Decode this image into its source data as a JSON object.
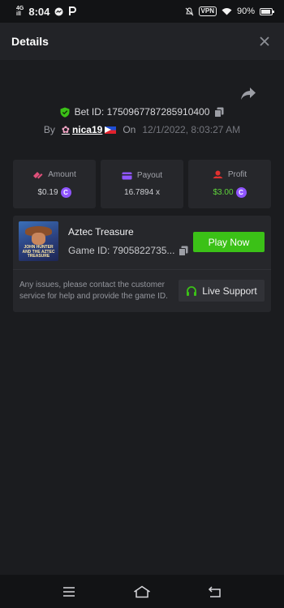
{
  "status_bar": {
    "network_top": "4G",
    "network_bottom": "ill",
    "time": "8:04",
    "vpn": "VPN",
    "battery": "90%"
  },
  "header": {
    "title": "Details"
  },
  "bet": {
    "id_label": "Bet ID: 1750967787285910400",
    "by_label": "By",
    "username": "nica19",
    "on_label": "On",
    "date": "12/1/2022, 8:03:27 AM"
  },
  "stats": [
    {
      "label": "Amount",
      "value": "$0.19",
      "icon": "coins-icon",
      "color": "#e0507a"
    },
    {
      "label": "Payout",
      "value": "16.7894 x",
      "icon": "card-icon",
      "color": "#8f55ff"
    },
    {
      "label": "Profit",
      "value": "$3.00",
      "icon": "profit-icon",
      "color": "#e0312f"
    }
  ],
  "game": {
    "name": "Aztec Treasure",
    "id_text": "Game ID: 7905822735...",
    "thumb_text": "JOHN HUNTER AND THE AZTEC TREASURE",
    "play_label": "Play Now"
  },
  "support": {
    "text": "Any issues, please contact the customer service for help and provide the game ID.",
    "button_label": "Live Support"
  },
  "colors": {
    "accent_green": "#3bc117",
    "coin_purple": "#8f55ff",
    "background": "#1b1c1f",
    "card": "#26272b"
  }
}
